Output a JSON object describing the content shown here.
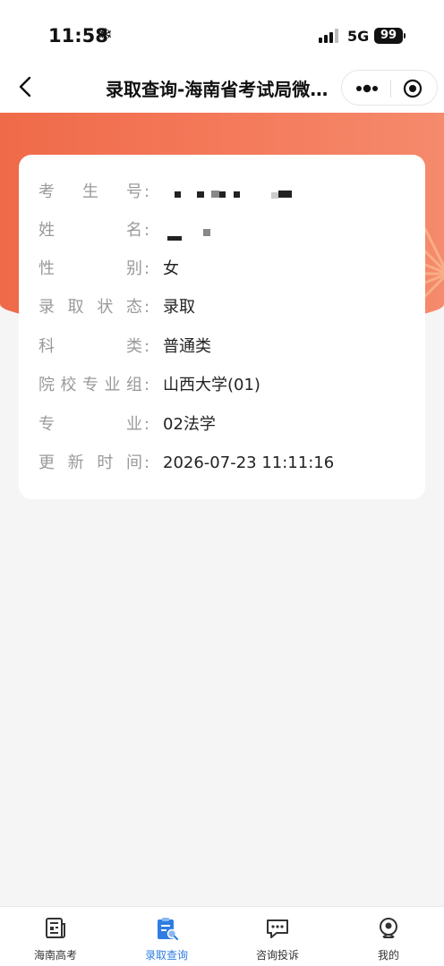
{
  "status_bar": {
    "time": "11:58",
    "network": "5G",
    "battery": "99"
  },
  "nav": {
    "title": "录取查询-海南省考试局微信公众号"
  },
  "card": {
    "rows": [
      {
        "label": "考生号",
        "value": ""
      },
      {
        "label": "姓名",
        "value": ""
      },
      {
        "label": "性别",
        "value": "女"
      },
      {
        "label": "录取状态",
        "value": "录取"
      },
      {
        "label": "科类",
        "value": "普通类"
      },
      {
        "label": "院校专业组",
        "value": "山西大学(01)"
      },
      {
        "label": "专业",
        "value": "02法学"
      },
      {
        "label": "更新时间",
        "value": "2026-07-23 11:11:16"
      }
    ]
  },
  "tabs": [
    {
      "label": "海南高考",
      "icon": "news-icon"
    },
    {
      "label": "录取查询",
      "icon": "clipboard-search-icon",
      "active": true
    },
    {
      "label": "咨询投诉",
      "icon": "chat-icon"
    },
    {
      "label": "我的",
      "icon": "profile-icon"
    }
  ],
  "colors": {
    "banner": "#ef6a49",
    "accent": "#2f7de1"
  }
}
